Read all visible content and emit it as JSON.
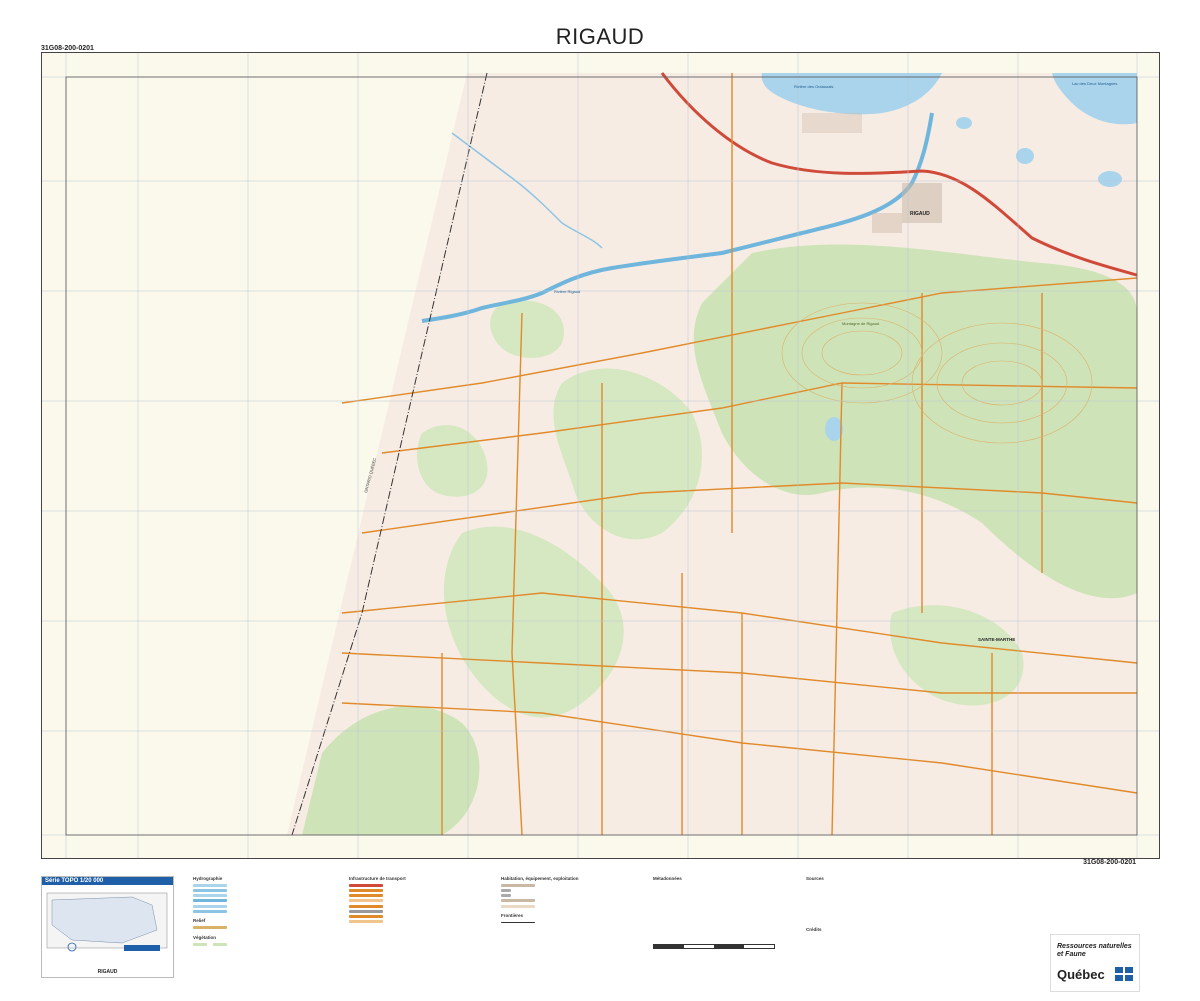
{
  "map": {
    "title": "RIGAUD",
    "sheet_code": "31G08-200-0201"
  },
  "labels": {
    "riviere_delisle": "Rivière des Outaouais",
    "lac_deux_montagnes": "Lac des Deux Montagnes",
    "rigaud_town": "RIGAUD",
    "riviere_rigaud": "Rivière Rigaud",
    "sainte_marthe": "SAINTE-MARTHE",
    "mont_rigaud": "Montagne de Rigaud",
    "ontario_quebec": "ONTARIO QUÉBEC"
  },
  "legend": {
    "serie": "Série TOPO 1/20 000",
    "serie_name": "RIGAUD",
    "hydro_title": "Hydrographie",
    "relief_title": "Relief",
    "veg_title": "Végétation",
    "transport_title": "Infrastructure de transport",
    "habitation_title": "Habitation, équipement, exploitation",
    "frontieres_title": "Frontières",
    "meta_title": "Métadonnées",
    "sources_title": "Sources",
    "credits_title": "Crédits"
  },
  "logo": {
    "line1": "Ressources naturelles",
    "line2": "et Faune",
    "brand": "Québec"
  },
  "colors": {
    "background": "#f7f1e3",
    "vegetation": "#cfe3b8",
    "water": "#a9d4ec",
    "road": "#e08a2a",
    "highway": "#d04a3a",
    "contour": "#d9b26a",
    "grid": "#b8c6d6"
  }
}
